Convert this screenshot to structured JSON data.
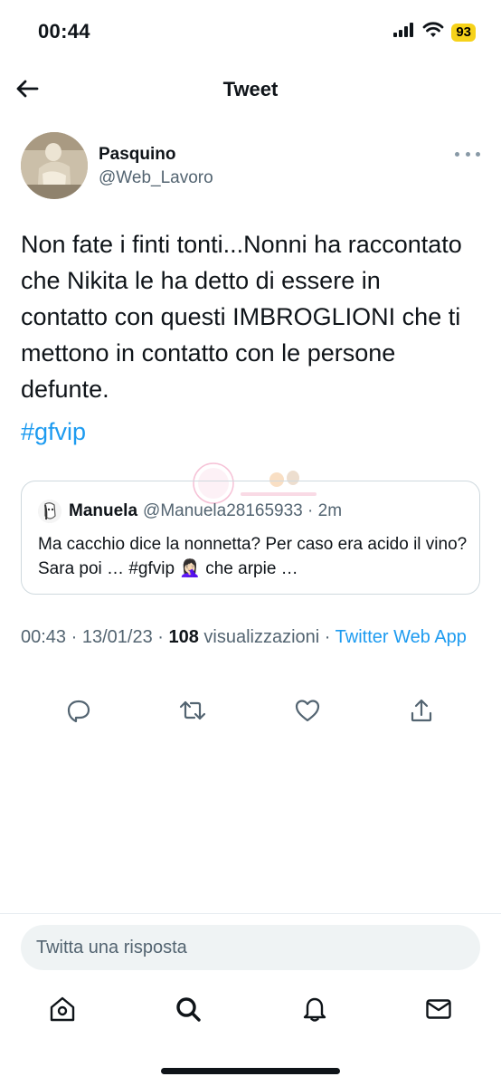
{
  "status_bar": {
    "time": "00:44",
    "battery": "93",
    "icons": [
      "signal-icon",
      "wifi-icon",
      "battery-icon"
    ]
  },
  "header": {
    "back_icon": "arrow-left-icon",
    "title": "Tweet"
  },
  "author": {
    "name": "Pasquino",
    "handle": "@Web_Lavoro",
    "more_icon": "more-dots-icon"
  },
  "tweet": {
    "text": "Non fate i finti tonti...Nonni ha raccontato che Nikita le ha detto di essere in contatto con questi IMBROGLIONI che ti mettono in contatto con le persone defunte.",
    "hashtag": "#gfvip"
  },
  "quote": {
    "name": "Manuela",
    "handle": "@Manuela28165933 · 2m",
    "text": "Ma cacchio dice la nonnetta? Per caso era acido il vino? Sara poi … #gfvip 🤦🏻‍♀️ che arpie …"
  },
  "meta": {
    "time": "00:43",
    "sep1": " · ",
    "date": "13/01/23",
    "sep2": " · ",
    "views_count": "108",
    "views_label": " visualizzazioni",
    "sep3": " · ",
    "source": "Twitter Web App"
  },
  "actions": [
    {
      "icon": "reply-icon"
    },
    {
      "icon": "retweet-icon"
    },
    {
      "icon": "like-icon"
    },
    {
      "icon": "share-icon"
    }
  ],
  "reply": {
    "placeholder": "Twitta una risposta"
  },
  "tabbar": [
    {
      "icon": "home-icon"
    },
    {
      "icon": "search-icon"
    },
    {
      "icon": "notifications-icon"
    },
    {
      "icon": "messages-icon"
    }
  ],
  "colors": {
    "accent": "#1d9bf0",
    "text": "#0f1419",
    "secondary": "#536471",
    "battery": "#f6d21a"
  }
}
